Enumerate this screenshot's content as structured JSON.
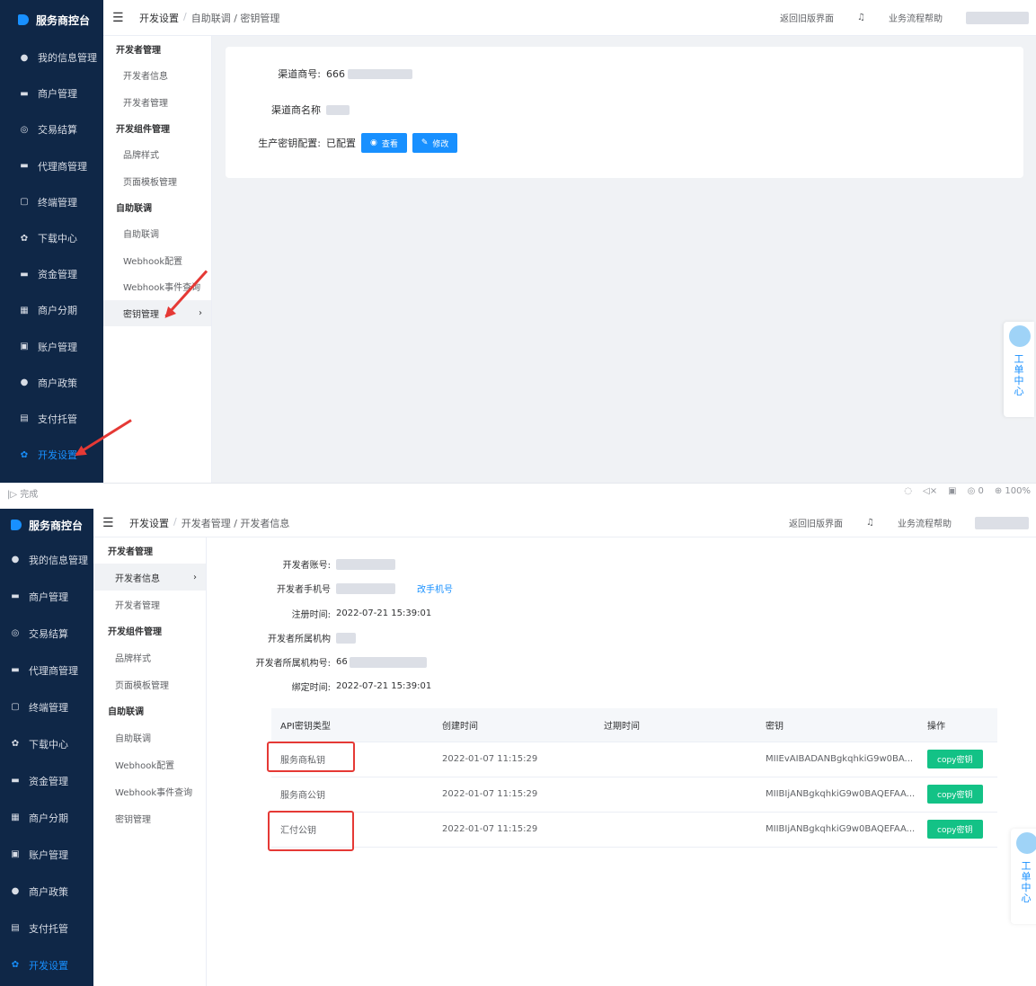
{
  "brand": "服务商控台",
  "nav_items": [
    {
      "label": "我的信息管理",
      "icon": "user-icon"
    },
    {
      "label": "商户管理",
      "icon": "shop-icon"
    },
    {
      "label": "交易结算",
      "icon": "settle-icon"
    },
    {
      "label": "代理商管理",
      "icon": "agent-icon"
    },
    {
      "label": "终端管理",
      "icon": "terminal-icon"
    },
    {
      "label": "下载中心",
      "icon": "download-icon"
    },
    {
      "label": "资金管理",
      "icon": "fund-icon"
    },
    {
      "label": "商户分期",
      "icon": "installment-icon"
    },
    {
      "label": "账户管理",
      "icon": "account-icon"
    },
    {
      "label": "商户政策",
      "icon": "policy-icon"
    },
    {
      "label": "支付托管",
      "icon": "escrow-icon"
    },
    {
      "label": "开发设置",
      "icon": "settings-icon"
    }
  ],
  "submenu": {
    "g1": "开发者管理",
    "i1": "开发者信息",
    "i2": "开发者管理",
    "g2": "开发组件管理",
    "i3": "品牌样式",
    "i4": "页面模板管理",
    "g3": "自助联调",
    "i5": "自助联调",
    "i6": "Webhook配置",
    "i7": "Webhook事件查询",
    "i8": "密钥管理"
  },
  "header": {
    "return_old": "返回旧版界面",
    "help": "业务流程帮助",
    "sep": "/"
  },
  "shot1": {
    "crumb1": "开发设置",
    "crumb2": "自助联调 / 密钥管理",
    "channel_no_label": "渠道商号:",
    "channel_no_value": "666",
    "channel_name_label": "渠道商名称",
    "prod_key_label": "生产密钥配置:",
    "prod_key_value": "已配置",
    "view_btn": "查看",
    "edit_btn": "修改"
  },
  "statusbar": {
    "left": "完成",
    "zoom": "100%",
    "badge": "0"
  },
  "shot2": {
    "crumb1": "开发设置",
    "crumb2": "开发者管理 / 开发者信息",
    "account_label": "开发者账号:",
    "phone_label": "开发者手机号",
    "phone_link": "改手机号",
    "reg_label": "注册时间:",
    "reg_value": "2022-07-21 15:39:01",
    "org_label": "开发者所属机构",
    "org_no_label": "开发者所属机构号:",
    "org_no_value": "66",
    "bind_label": "绑定时间:",
    "bind_value": "2022-07-21 15:39:01",
    "table_headers": [
      "API密钥类型",
      "创建时间",
      "过期时间",
      "密钥",
      "操作"
    ],
    "rows": [
      {
        "type": "服务商私钥",
        "created": "2022-01-07 11:15:29",
        "expire": "",
        "key": "MIIEvAIBADANBgkqhkiG9w0BA...",
        "action": "copy密钥"
      },
      {
        "type": "服务商公钥",
        "created": "2022-01-07 11:15:29",
        "expire": "",
        "key": "MIIBIjANBgkqhkiG9w0BAQEFAA...",
        "action": "copy密钥"
      },
      {
        "type": "汇付公钥",
        "created": "2022-01-07 11:15:29",
        "expire": "",
        "key": "MIIBIjANBgkqhkiG9w0BAQEFAA...",
        "action": "copy密钥"
      }
    ]
  },
  "widget": [
    "工",
    "单",
    "中",
    "心"
  ],
  "colors": {
    "nav_bg": "#0f2747",
    "accent": "#1890ff",
    "copy_btn": "#13c286",
    "highlight": "#e53935"
  }
}
